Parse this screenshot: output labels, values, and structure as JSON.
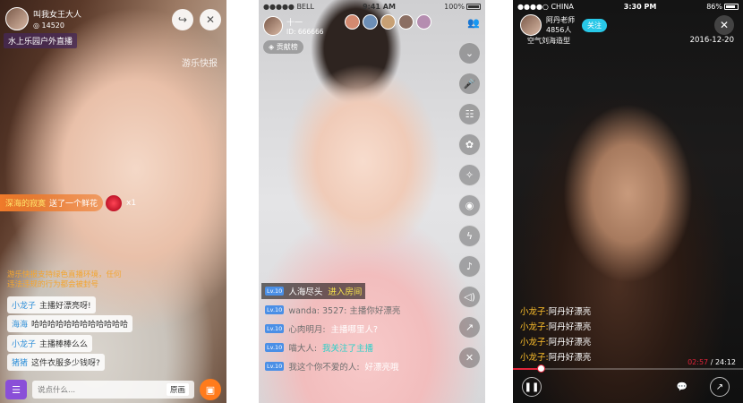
{
  "phone1": {
    "host_name": "叫我女王大人",
    "host_fans": "14520",
    "room_title": "水上乐园户外直播",
    "watermark": "游乐快报",
    "share_icon": "share-icon",
    "close_icon": "close-icon",
    "gift": {
      "from": "深海的寂寞",
      "text": "送了一个鲜花",
      "count": "x1"
    },
    "notice": "游乐快报支持绿色直播环境，任何违法违规的行为都会被封号",
    "chats": [
      {
        "user": "小龙子",
        "text": "主播好漂亮呀!"
      },
      {
        "user": "海海",
        "text": "哈哈哈哈哈哈哈哈哈哈哈哈"
      },
      {
        "user": "小龙子",
        "text": "主播棒棒么么"
      },
      {
        "user": "猪猪",
        "text": "这件衣服多少钱呀?"
      }
    ],
    "input_placeholder": "说点什么...",
    "original_label": "原画",
    "accent_color": "#8a4fd8",
    "gift_button_color": "#ff7b1c"
  },
  "phone2": {
    "status": {
      "carrier": "●●●●● BELL",
      "time": "9:41 AM",
      "battery": "100%"
    },
    "host_name": "十一",
    "host_id": "ID: 666666",
    "contribution": "贡献榜",
    "side_buttons": [
      "chevron-down-icon",
      "mic-icon",
      "chat-icon",
      "sticker-icon",
      "magic-wand-icon",
      "camera-icon",
      "flash-icon",
      "bell-icon",
      "speaker-icon",
      "share-icon",
      "close-icon"
    ],
    "chats": [
      {
        "level": "Lv.10",
        "user": "人海尽头",
        "text": "进入房间",
        "style": "highlight"
      },
      {
        "level": "Lv.10",
        "user": "wanda",
        "text": "wanda: 3527: 主播你好漂亮",
        "style": "dim"
      },
      {
        "level": "Lv.10",
        "user": "心肉明月:",
        "text": "主播哪里人?",
        "style": "dim"
      },
      {
        "level": "Lv.10",
        "user": "喵大人:",
        "text": "我关注了主播",
        "style": "teal"
      },
      {
        "level": "Lv.10",
        "user": "我这个你不爱的人:",
        "text": "好漂亮哦",
        "style": "white"
      }
    ]
  },
  "phone3": {
    "status": {
      "carrier": "●●●●○ CHINA",
      "time": "3:30 PM",
      "battery": "86%"
    },
    "host_name": "阿丹老师",
    "viewer_count": "4856人",
    "follow_label": "关注",
    "tag": "空气刘海造型",
    "date": "2016-12-20",
    "chats": [
      {
        "user": "小龙子:",
        "text": "阿丹好漂亮"
      },
      {
        "user": "小龙子:",
        "text": "阿丹好漂亮"
      },
      {
        "user": "小龙子:",
        "text": "阿丹好漂亮"
      },
      {
        "user": "小龙子:",
        "text": "阿丹好漂亮"
      }
    ],
    "time_current": "02:57",
    "time_total": "24:12",
    "progress": 0.12,
    "progress_color": "#e0243a"
  }
}
